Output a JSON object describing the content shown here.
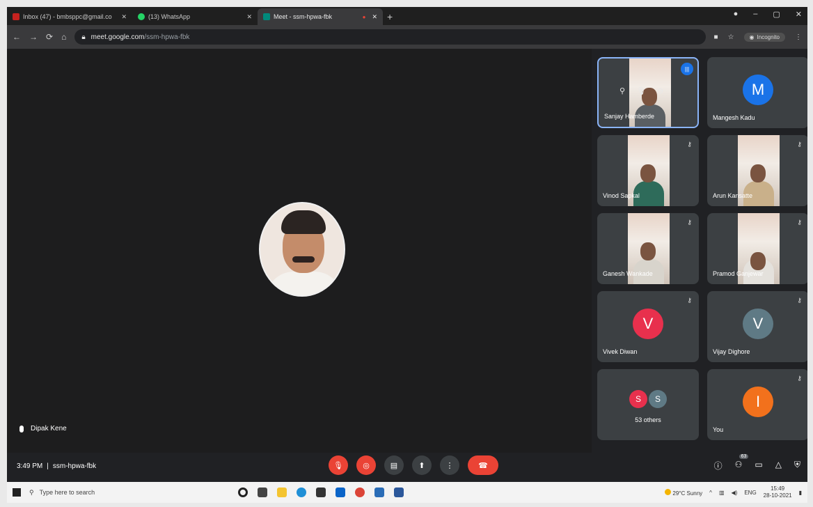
{
  "browser": {
    "tabs": [
      {
        "label": "Inbox (47) - bmbsppc@gmail.co",
        "active": false,
        "color": "#c5221f"
      },
      {
        "label": "(13) WhatsApp",
        "active": false,
        "color": "#25d366"
      },
      {
        "label": "Meet - ssm-hpwa-fbk",
        "active": true,
        "color": "#00897b"
      }
    ],
    "url_host": "meet.google.com",
    "url_path": "/ssm-hpwa-fbk",
    "profile_label": "Incognito"
  },
  "stage": {
    "speaker_name": "Dipak Kene"
  },
  "tiles": [
    {
      "name": "Sanjay Hamberde",
      "type": "video",
      "focused": true
    },
    {
      "name": "Mangesh Kadu",
      "type": "letter",
      "letter": "M",
      "color": "#1a73e8"
    },
    {
      "name": "Vinod Sapkal",
      "type": "video"
    },
    {
      "name": "Arun Kansatte",
      "type": "video"
    },
    {
      "name": "Ganesh Wankade",
      "type": "video"
    },
    {
      "name": "Pramod Ganjewar",
      "type": "video"
    },
    {
      "name": "Vivek Diwan",
      "type": "letter",
      "letter": "V",
      "color": "#e8304d"
    },
    {
      "name": "Vijay Dighore",
      "type": "letter",
      "letter": "V",
      "color": "#5f7a85"
    },
    {
      "name": "53 others",
      "type": "others",
      "letters": [
        "S",
        "S"
      ],
      "colors": [
        "#e8304d",
        "#5f7a85"
      ]
    },
    {
      "name": "You",
      "type": "letter",
      "letter": "I",
      "color": "#f2711c"
    }
  ],
  "meeting": {
    "time": "3:49 PM",
    "separator": "|",
    "code": "ssm-hpwa-fbk",
    "participants_count": "63"
  },
  "taskbar": {
    "search_placeholder": "Type here to search",
    "weather": "29°C Sunny",
    "lang": "ENG",
    "time": "15:49",
    "date": "28-10-2021"
  }
}
